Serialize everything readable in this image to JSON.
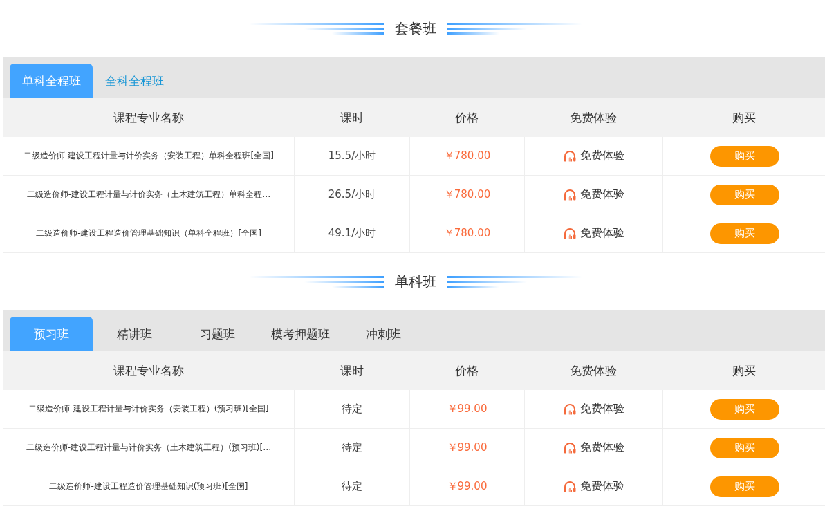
{
  "sections": [
    {
      "title": "套餐班",
      "tabs": [
        {
          "label": "单科全程班",
          "selected": true
        },
        {
          "label": "全科全程班",
          "selected": false
        }
      ],
      "columns": [
        "课程专业名称",
        "课时",
        "价格",
        "免费体验",
        "购买"
      ],
      "rows": [
        {
          "name": "二级造价师-建设工程计量与计价实务（安装工程）单科全程班[全国]",
          "hours": "15.5/小时",
          "price": "￥780.00",
          "trial": "免费体验",
          "buy": "购买"
        },
        {
          "name": "二级造价师-建设工程计量与计价实务（土木建筑工程）单科全程…",
          "hours": "26.5/小时",
          "price": "￥780.00",
          "trial": "免费体验",
          "buy": "购买"
        },
        {
          "name": "二级造价师-建设工程造价管理基础知识（单科全程班）[全国]",
          "hours": "49.1/小时",
          "price": "￥780.00",
          "trial": "免费体验",
          "buy": "购买"
        }
      ]
    },
    {
      "title": "单科班",
      "tabs": [
        {
          "label": "预习班",
          "selected": true
        },
        {
          "label": "精讲班",
          "selected": false
        },
        {
          "label": "习题班",
          "selected": false
        },
        {
          "label": "模考押题班",
          "selected": false
        },
        {
          "label": "冲刺班",
          "selected": false
        }
      ],
      "columns": [
        "课程专业名称",
        "课时",
        "价格",
        "免费体验",
        "购买"
      ],
      "rows": [
        {
          "name": "二级造价师-建设工程计量与计价实务（安装工程）(预习班)[全国]",
          "hours": "待定",
          "price": "￥99.00",
          "trial": "免费体验",
          "buy": "购买"
        },
        {
          "name": "二级造价师-建设工程计量与计价实务（土木建筑工程）(预习班)[…",
          "hours": "待定",
          "price": "￥99.00",
          "trial": "免费体验",
          "buy": "购买"
        },
        {
          "name": "二级造价师-建设工程造价管理基础知识(预习班)[全国]",
          "hours": "待定",
          "price": "￥99.00",
          "trial": "免费体验",
          "buy": "购买"
        }
      ]
    }
  ]
}
